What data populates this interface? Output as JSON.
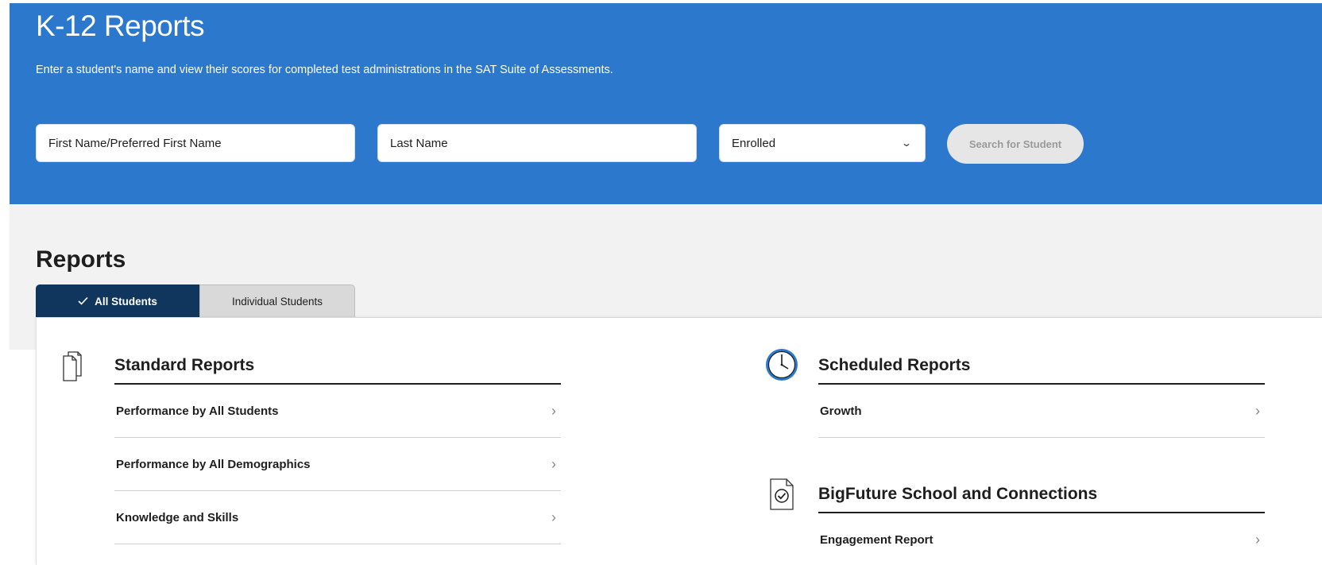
{
  "hero": {
    "title": "K-12 Reports",
    "description": "Enter a student's name and view their scores for completed test administrations in the SAT Suite of Assessments.",
    "first_name_placeholder": "First Name/Preferred First Name",
    "last_name_placeholder": "Last Name",
    "enrollment_value": "Enrolled",
    "search_label": "Search for Student"
  },
  "reports": {
    "title": "Reports",
    "tabs": [
      {
        "label": "All Students",
        "selected": true
      },
      {
        "label": "Individual Students",
        "selected": false
      }
    ],
    "standard": {
      "title": "Standard Reports",
      "icon": "documents-icon",
      "items": [
        "Performance by All Students",
        "Performance by All Demographics",
        "Knowledge and Skills"
      ]
    },
    "scheduled": {
      "title": "Scheduled Reports",
      "icon": "clock-icon",
      "items": [
        "Growth"
      ]
    },
    "bigfuture": {
      "title": "BigFuture School and Connections",
      "icon": "document-check-icon",
      "items": [
        "Engagement Report"
      ]
    }
  },
  "colors": {
    "hero_blue": "#2b78cd",
    "tab_active": "#10365e",
    "search_disabled_bg": "#e6e6e6"
  }
}
